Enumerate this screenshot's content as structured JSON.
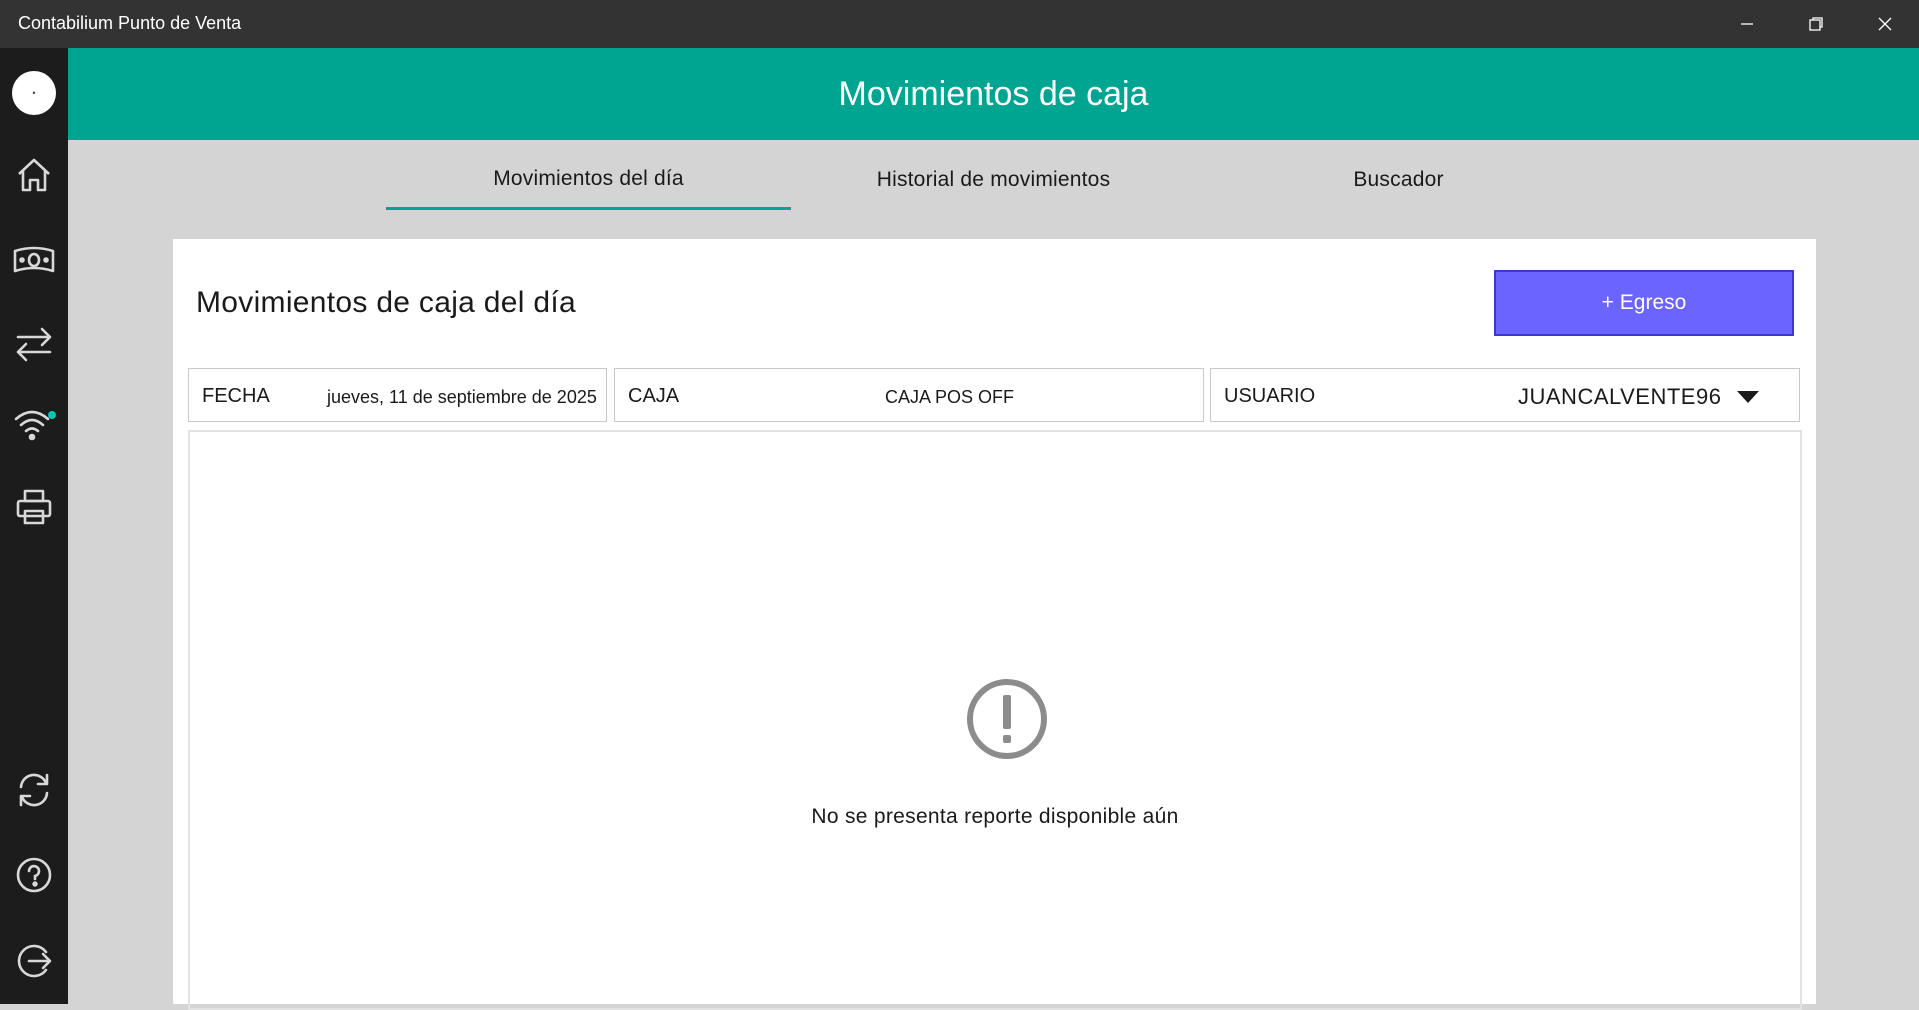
{
  "window": {
    "title": "Contabilium Punto de Venta",
    "controls": [
      "minimize-icon",
      "restore-icon",
      "close-icon"
    ]
  },
  "sidebar": {
    "avatar_text": "•",
    "items": [
      {
        "icon": "home-icon"
      },
      {
        "icon": "cash-icon"
      },
      {
        "icon": "transfer-arrows-icon"
      },
      {
        "icon": "wifi-icon",
        "status_dot_color": "#00c9b1"
      },
      {
        "icon": "printer-icon"
      },
      {
        "icon": "sync-icon"
      },
      {
        "icon": "help-icon"
      },
      {
        "icon": "logout-icon"
      }
    ]
  },
  "header": {
    "title": "Movimientos de caja",
    "color": "#00a591"
  },
  "tabs": [
    {
      "label": "Movimientos del día",
      "active": true
    },
    {
      "label": "Historial de movimientos",
      "active": false
    },
    {
      "label": "Buscador",
      "active": false
    }
  ],
  "card": {
    "title": "Movimientos de caja del día",
    "egreso_button": "+ Egreso",
    "button_color": "#6b64ff"
  },
  "filters": {
    "fecha": {
      "label": "FECHA",
      "value": "jueves, 11 de septiembre de 2025"
    },
    "caja": {
      "label": "CAJA",
      "value": "CAJA POS OFF"
    },
    "usuario": {
      "label": "USUARIO",
      "value": "JUANCALVENTE96"
    }
  },
  "empty_state": {
    "icon": "exclamation-circle-icon",
    "message": "No se presenta reporte disponible aún"
  }
}
